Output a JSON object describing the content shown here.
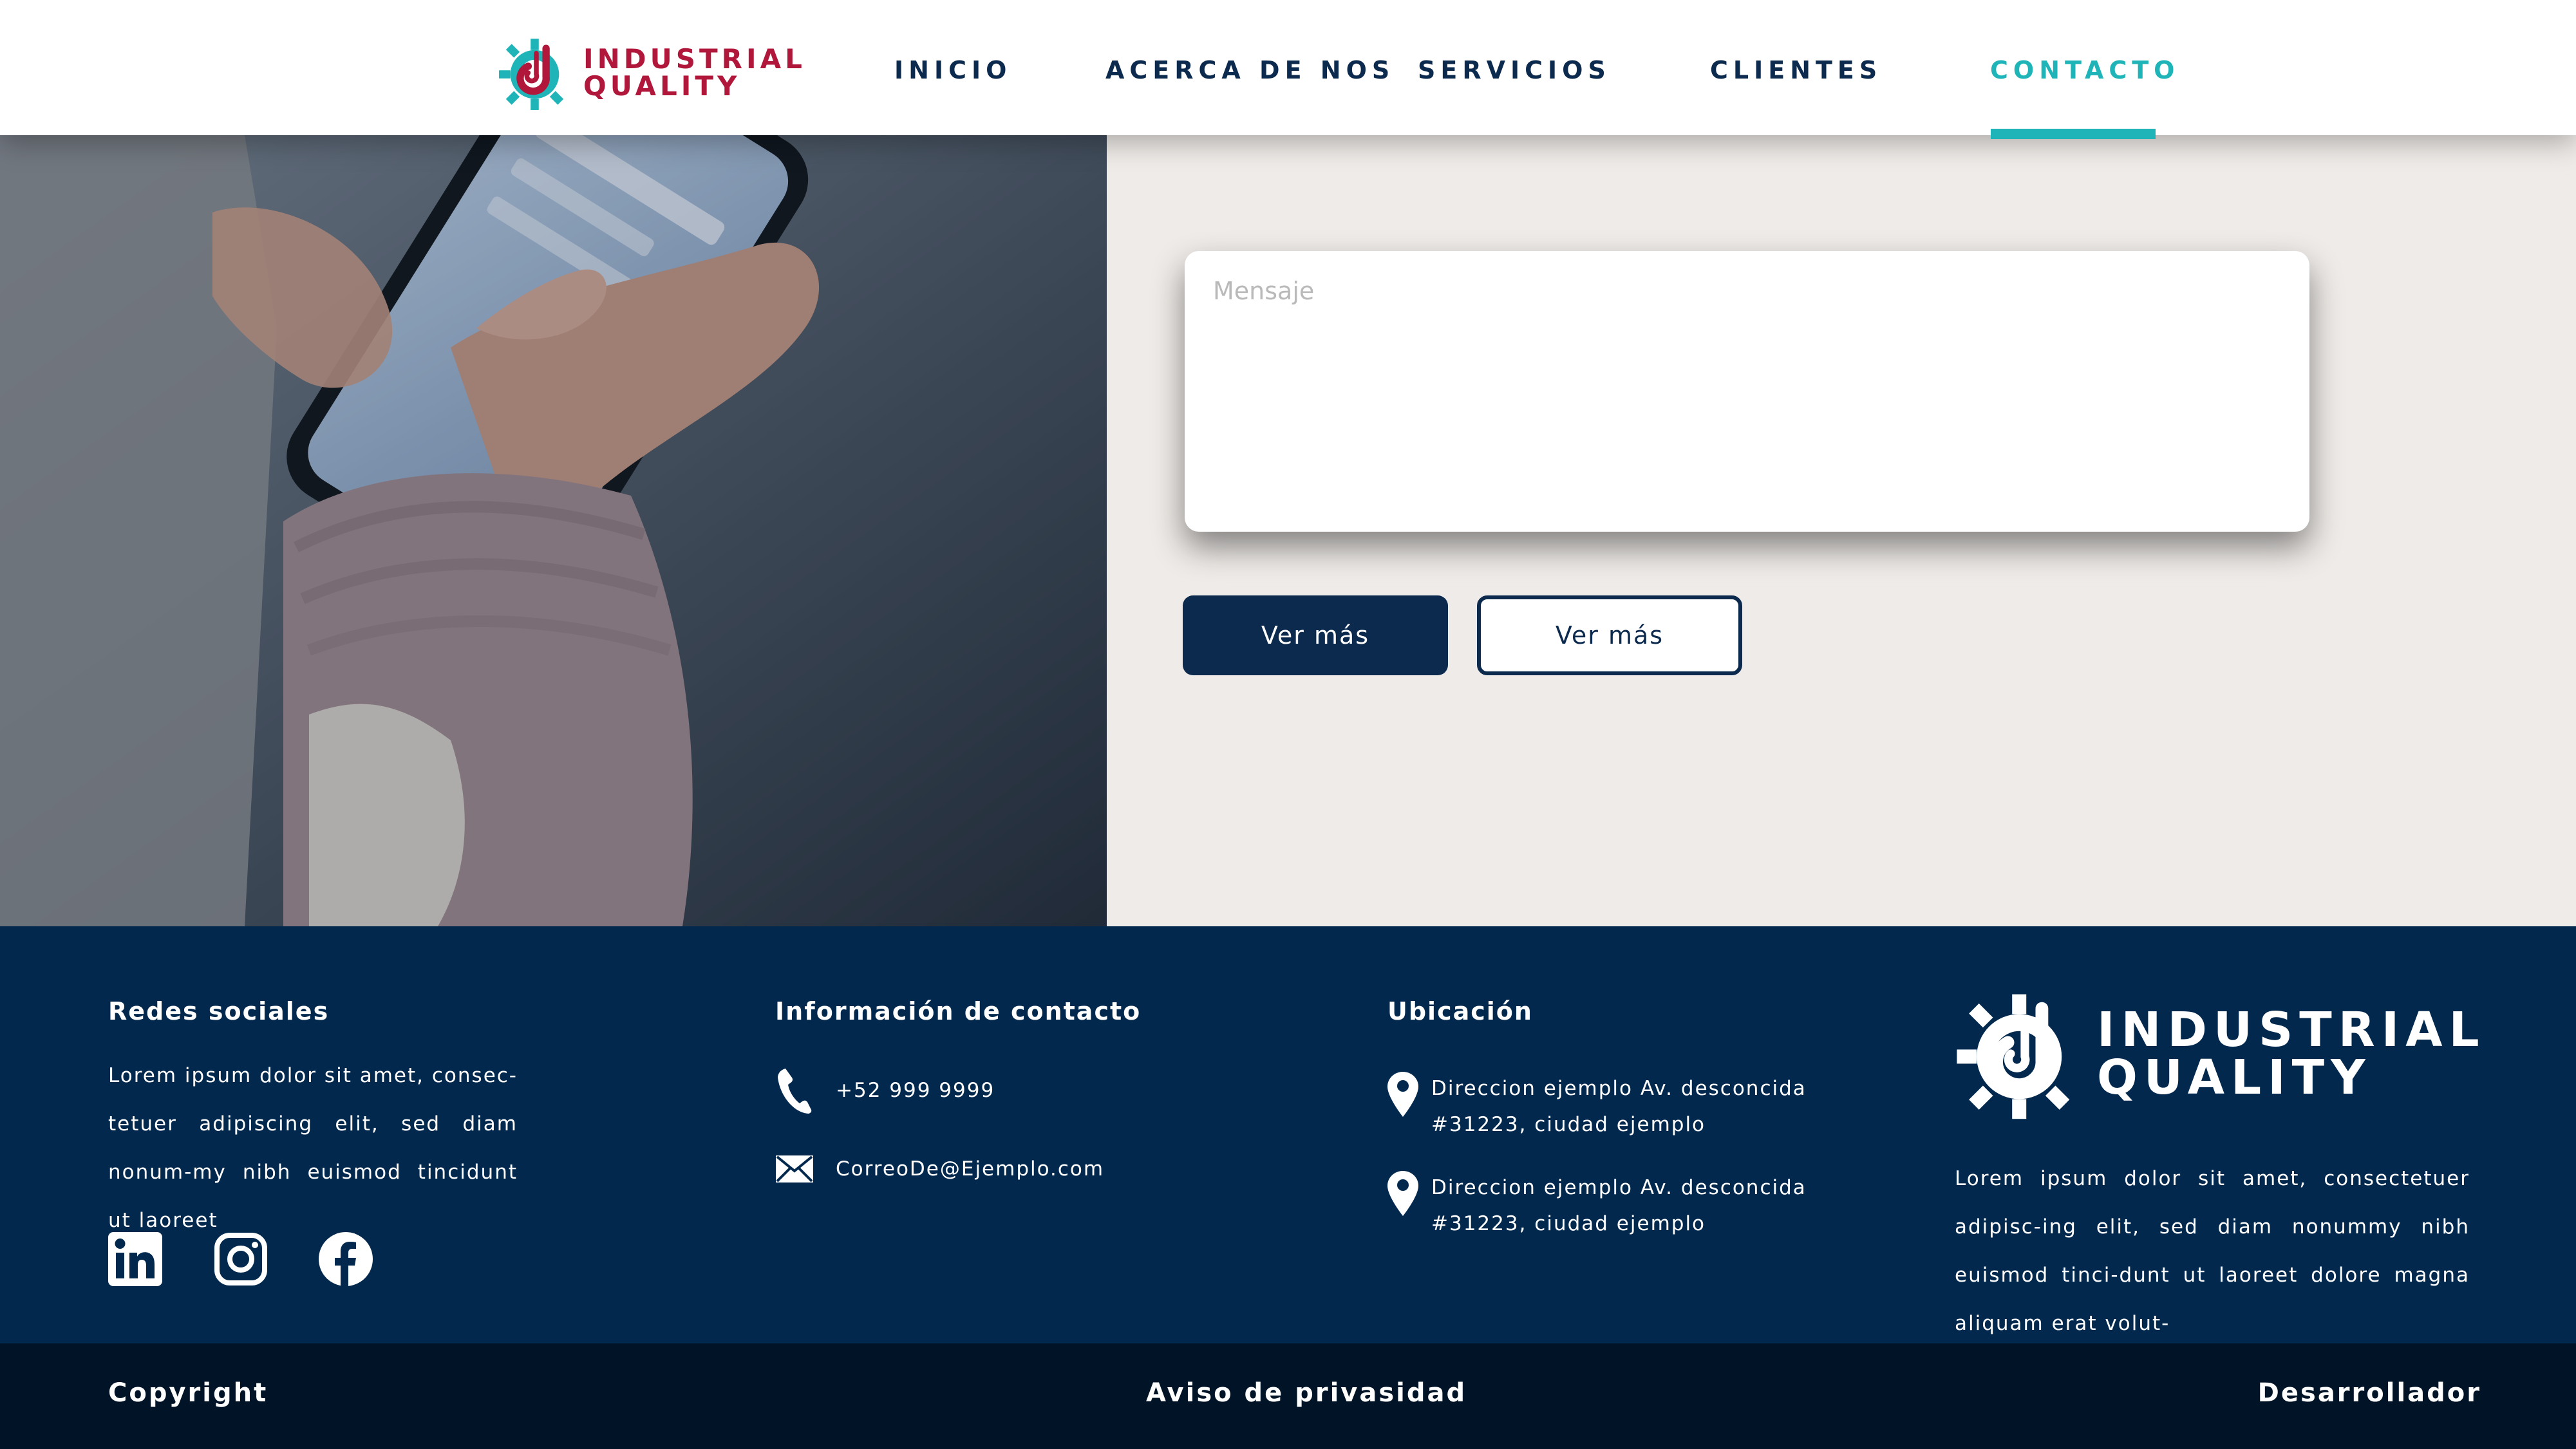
{
  "brand": {
    "line1": "INDUSTRIAL",
    "line2": "QUALITY",
    "primary_color": "#b0173a",
    "accent_color": "#1fb5b8",
    "navy_color": "#0c2a4d"
  },
  "nav": {
    "items": [
      {
        "label": "INICIO"
      },
      {
        "label": "ACERCA DE NOS"
      },
      {
        "label": "SERVICIOS"
      },
      {
        "label": "CLIENTES"
      },
      {
        "label": "CONTACTO",
        "active": true
      }
    ]
  },
  "form": {
    "message_placeholder": "Mensaje",
    "primary_button": "Ver más",
    "secondary_button": "Ver más"
  },
  "footer": {
    "social": {
      "heading": "Redes sociales",
      "text": "Lorem ipsum dolor sit amet, consec-tetuer adipiscing elit, sed diam nonum-my nibh euismod tincidunt ut laoreet",
      "icons": [
        "linkedin-icon",
        "instagram-icon",
        "facebook-icon"
      ]
    },
    "contact": {
      "heading": "Información de contacto",
      "phone": "+52 999 9999",
      "email": "CorreoDe@Ejemplo.com"
    },
    "location": {
      "heading": "Ubicación",
      "addresses": [
        {
          "line1": "Direccion ejemplo Av. desconcida",
          "line2": "#31223, ciudad ejemplo"
        },
        {
          "line1": "Direccion ejemplo Av. desconcida",
          "line2": "#31223, ciudad ejemplo"
        }
      ]
    },
    "about": {
      "text": "Lorem ipsum dolor sit amet, consectetuer adipisc-ing elit, sed diam nonummy nibh euismod tinci-dunt ut laoreet dolore magna aliquam erat volut-"
    }
  },
  "bottom_bar": {
    "copyright": "Copyright",
    "privacy": "Aviso de privasidad",
    "developer": "Desarrollador"
  }
}
